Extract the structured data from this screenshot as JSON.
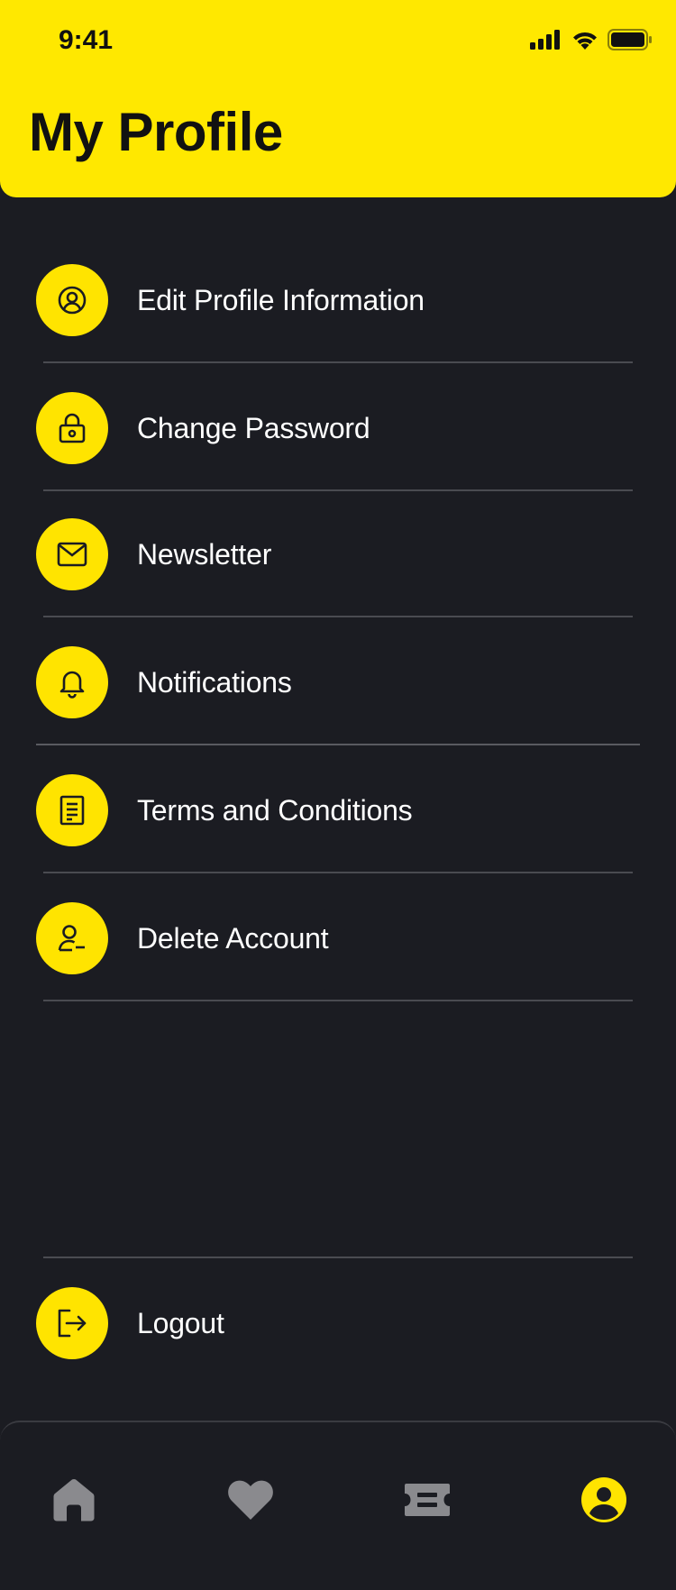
{
  "status_bar": {
    "time": "9:41"
  },
  "header": {
    "title": "My Profile"
  },
  "menu": {
    "items": [
      {
        "label": "Edit Profile Information",
        "icon": "user-circle-icon"
      },
      {
        "label": "Change Password",
        "icon": "lock-icon"
      },
      {
        "label": "Newsletter",
        "icon": "mail-icon"
      },
      {
        "label": "Notifications",
        "icon": "bell-icon"
      },
      {
        "label": "Terms and Conditions",
        "icon": "document-icon"
      },
      {
        "label": "Delete Account",
        "icon": "user-minus-icon"
      }
    ],
    "logout": {
      "label": "Logout",
      "icon": "logout-icon"
    }
  },
  "tabbar": {
    "tabs": [
      {
        "name": "home",
        "icon": "home-icon",
        "active": false
      },
      {
        "name": "favorites",
        "icon": "heart-icon",
        "active": false
      },
      {
        "name": "tickets",
        "icon": "ticket-icon",
        "active": false
      },
      {
        "name": "profile",
        "icon": "profile-icon",
        "active": true
      }
    ]
  },
  "colors": {
    "accent": "#ffe800",
    "background": "#1b1c22",
    "inactive_tab": "#8a8a8e",
    "text": "#ffffff"
  }
}
